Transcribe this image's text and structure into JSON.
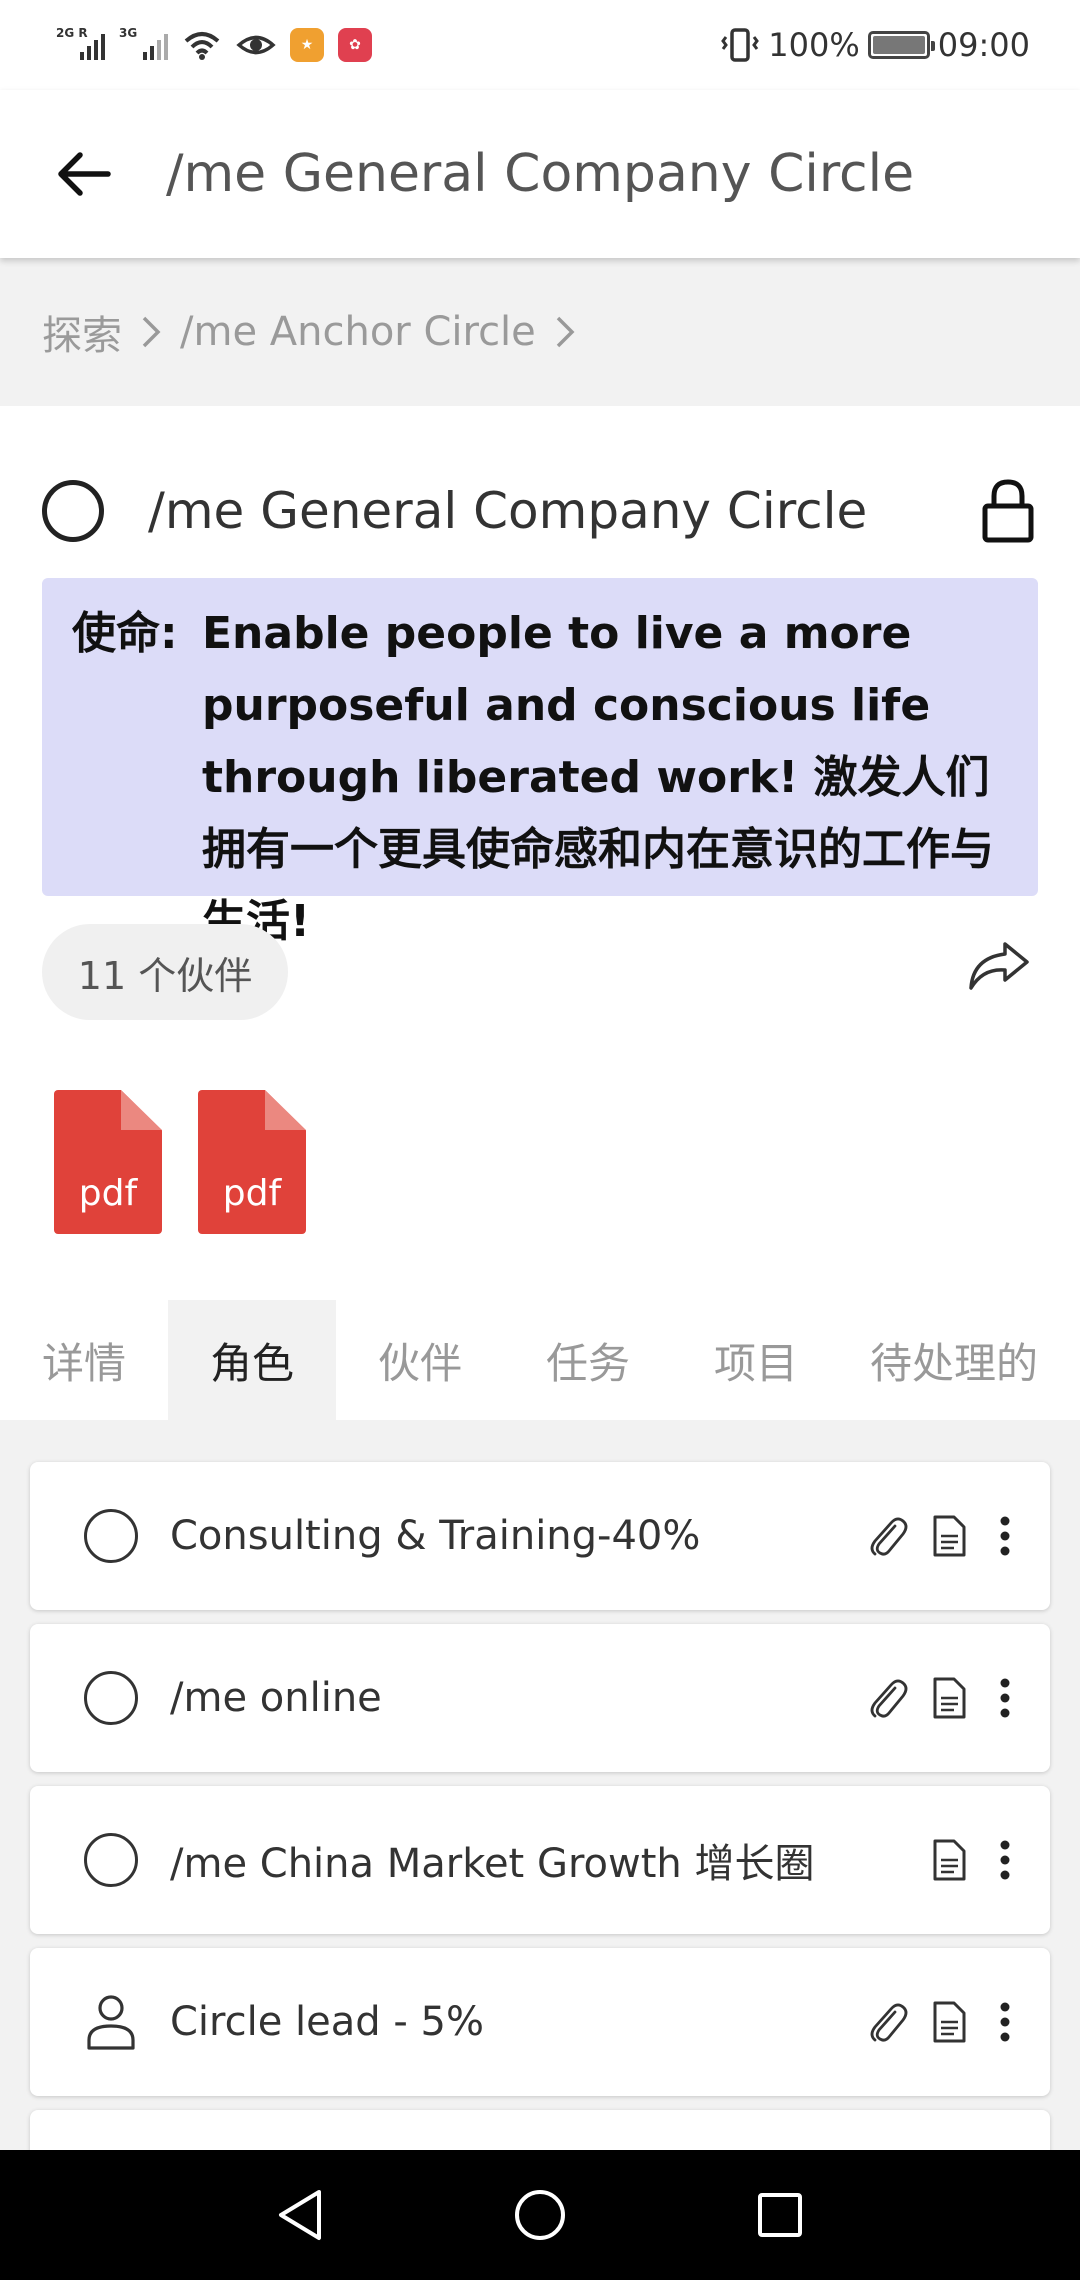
{
  "status_bar": {
    "signal1_label": "2G R",
    "signal2_label": "3G",
    "battery_percent": "100%",
    "time": "09:00",
    "battery_level": 1.0
  },
  "app_bar": {
    "title": "/me General Company Circle",
    "back_icon": "arrow-left-icon"
  },
  "breadcrumb": {
    "items": [
      "探索",
      "/me Anchor Circle"
    ]
  },
  "circle": {
    "name": "/me General Company Circle",
    "mission_label": "使命:",
    "mission_text": "Enable people to live a more purposeful and conscious life through liberated work! 激发人们拥有一个更具使命感和内在意识的工作与生活!",
    "partners_label": "11 个伙伴",
    "attachments": [
      {
        "ext": "pdf"
      },
      {
        "ext": "pdf"
      }
    ]
  },
  "tabs": [
    {
      "label": "详情",
      "active": false
    },
    {
      "label": "角色",
      "active": true
    },
    {
      "label": "伙伴",
      "active": false
    },
    {
      "label": "任务",
      "active": false
    },
    {
      "label": "项目",
      "active": false
    },
    {
      "label": "待处理的",
      "active": false
    }
  ],
  "roles": [
    {
      "label": "Consulting & Training-40%",
      "icon": "circle-icon",
      "has_attachment": true
    },
    {
      "label": "/me online",
      "icon": "circle-icon",
      "has_attachment": true
    },
    {
      "label": "/me China Market Growth 增长圈",
      "icon": "circle-icon",
      "has_attachment": false
    },
    {
      "label": "Circle lead - 5%",
      "icon": "person-icon",
      "has_attachment": true
    }
  ],
  "colors": {
    "mission_bg": "#dcdcf8",
    "pdf_red": "#e0423a",
    "accent_text": "#222222"
  }
}
